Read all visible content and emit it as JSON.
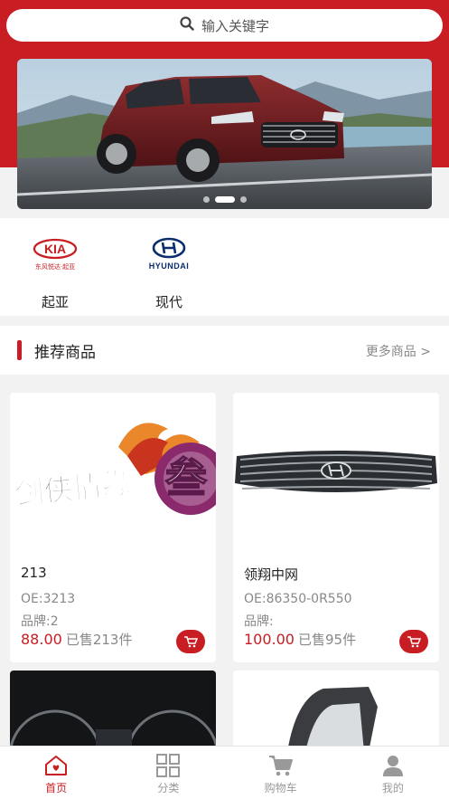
{
  "search": {
    "placeholder": "输入关键字",
    "icon": "search-icon"
  },
  "banner": {
    "dots": 3,
    "active_dot": 1
  },
  "brands": [
    {
      "label": "起亚",
      "logo_text": "KIA",
      "logo_sub": "东风悦达·起亚"
    },
    {
      "label": "现代",
      "logo_text": "HYUNDAI"
    }
  ],
  "recommend": {
    "title": "推荐商品",
    "more": "更多商品 >"
  },
  "products": [
    {
      "name": "213",
      "oe": "OE:3213",
      "brand": "品牌:2",
      "price": "88.00",
      "sold": "已售213件"
    },
    {
      "name": "领翔中网",
      "oe": "OE:86350-0R550",
      "brand": "品牌:",
      "price": "100.00",
      "sold": "已售95件"
    }
  ],
  "tabbar": [
    {
      "label": "首页",
      "icon": "home-icon",
      "active": true
    },
    {
      "label": "分类",
      "icon": "grid-icon",
      "active": false
    },
    {
      "label": "购物车",
      "icon": "cart-icon",
      "active": false
    },
    {
      "label": "我的",
      "icon": "user-icon",
      "active": false
    }
  ],
  "colors": {
    "accent": "#c81d22",
    "background": "#f2f2f2"
  }
}
